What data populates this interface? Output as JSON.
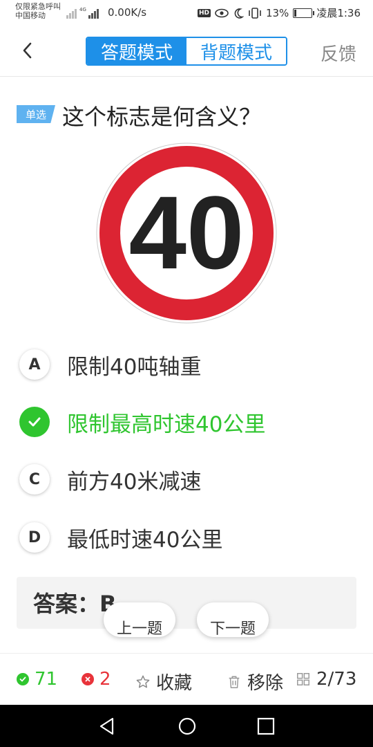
{
  "status_bar": {
    "carrier_line1": "仅限紧急呼叫",
    "carrier_line2": "中国移动",
    "net_label": "4G",
    "speed": "0.00K/s",
    "hd": "HD",
    "battery": "13%",
    "battery_level": 0.13,
    "time": "凌晨1:36"
  },
  "header": {
    "mode_answer": "答题模式",
    "mode_recite": "背题模式",
    "feedback": "反馈"
  },
  "question": {
    "type": "单选",
    "text": "这个标志是何含义？",
    "sign_number": "40"
  },
  "options": [
    {
      "letter": "A",
      "text": "限制40吨轴重"
    },
    {
      "letter": "B",
      "text": "限制最高时速40公里"
    },
    {
      "letter": "C",
      "text": "前方40米减速"
    },
    {
      "letter": "D",
      "text": "最低时速40公里"
    }
  ],
  "answer": {
    "label": "答案：B"
  },
  "nav": {
    "prev": "上一题",
    "next": "下一题"
  },
  "stats": {
    "correct": "71",
    "wrong": "2",
    "favorite": "收藏",
    "remove": "移除",
    "progress": "2/73"
  },
  "colors": {
    "accent": "#1e90e8",
    "correct": "#2fc52f",
    "wrong": "#e8333a"
  }
}
